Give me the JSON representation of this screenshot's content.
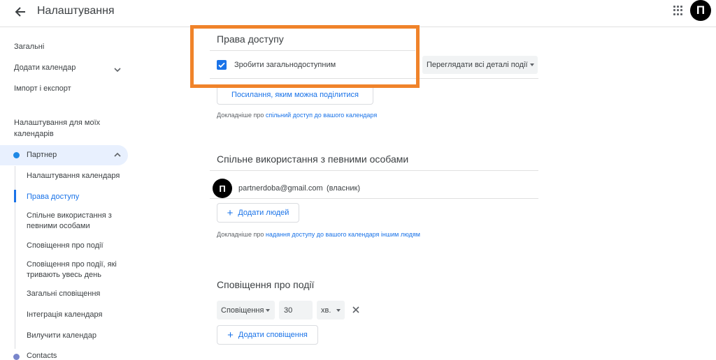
{
  "header": {
    "title": "Налаштування",
    "avatar_letter": "П"
  },
  "sidebar": {
    "items": [
      "Загальні",
      "Додати календар",
      "Імпорт і експорт"
    ],
    "my_calendars_heading": "Налаштування для моїх календарів",
    "calendar_name": "Партнер",
    "calendar_color": "#1e88e5",
    "sub_items": [
      "Налаштування календаря",
      "Права доступу",
      "Спільне використання з певними особами",
      "Сповіщення про події",
      "Сповіщення про події, які тривають увесь день",
      "Загальні сповіщення",
      "Інтеграція календаря",
      "Вилучити календар"
    ],
    "active_sub_item": "Права доступу",
    "contacts_label": "Contacts"
  },
  "access": {
    "title": "Права доступу",
    "public_checkbox_label": "Зробити загальнодоступним",
    "public_checked": true,
    "visibility_select": "Переглядати всі деталі події",
    "share_link_button": "Посилання, яким можна поділитися",
    "helper_prefix": "Докладніше про",
    "helper_link": "спільний доступ до вашого календаря"
  },
  "sharing": {
    "title": "Спільне використання з певними особами",
    "person_avatar_letter": "П",
    "person_email": "partnerdoba@gmail.com",
    "person_role": "(власник)",
    "add_people_button": "Додати людей",
    "helper_prefix": "Докладніше про",
    "helper_link": "надання доступу до вашого календаря іншим людям"
  },
  "notifications": {
    "title": "Сповіщення про події",
    "type_select": "Сповіщення",
    "amount": "30",
    "unit_select": "хв.",
    "add_button": "Додати сповіщення"
  },
  "colors": {
    "accent": "#1a73e8",
    "highlight": "#f0832a",
    "contacts": "#7986cb"
  }
}
